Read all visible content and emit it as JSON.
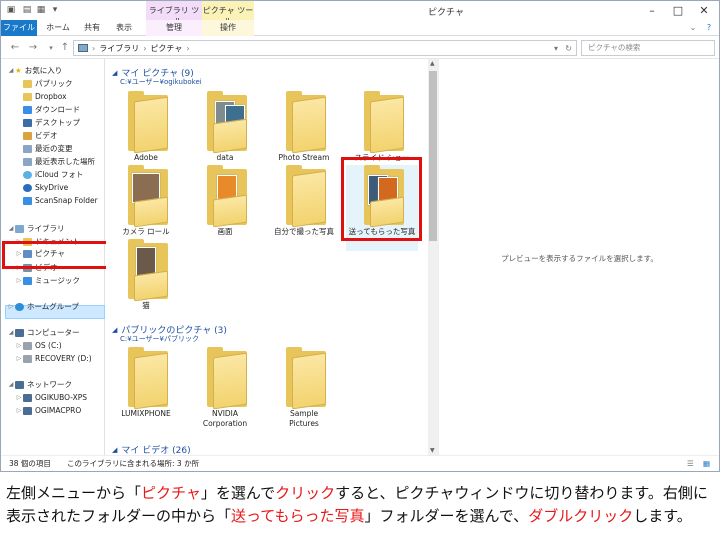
{
  "window": {
    "title": "ピクチャ",
    "ribbon_context_tabs": [
      "ライブラリ ツール",
      "ピクチャ ツール"
    ],
    "ribbon_tabs": [
      "ファイル",
      "ホーム",
      "共有",
      "表示",
      "管理",
      "操作"
    ]
  },
  "address": {
    "breadcrumb": [
      "ライブラリ",
      "ピクチャ"
    ],
    "search_placeholder": "ピクチャの検索"
  },
  "nav": {
    "favorites": "お気に入り",
    "favorites_items": [
      "パブリック",
      "Dropbox",
      "ダウンロード",
      "デスクトップ",
      "ビデオ",
      "最近の変更",
      "最近表示した場所",
      "iCloud フォト",
      "SkyDrive",
      "ScanSnap Folder"
    ],
    "libraries": "ライブラリ",
    "library_items": [
      "ドキュメント",
      "ピクチャ",
      "ビデオ",
      "ミュージック"
    ],
    "homegroup": "ホームグループ",
    "computer": "コンピューター",
    "computer_items": [
      "OS (C:)",
      "RECOVERY (D:)"
    ],
    "network": "ネットワーク",
    "network_items": [
      "OGIKUBO-XPS",
      "OGIMACPRO"
    ]
  },
  "groups": [
    {
      "title": "マイ ピクチャ (9)",
      "path": "C:¥ユーザー¥ogikubokei",
      "folders": [
        "Adobe",
        "data",
        "Photo Stream",
        "スライド ショー",
        "カメラ ロール",
        "画面",
        "自分で撮った写真",
        "送ってもらった写真",
        "猫"
      ]
    },
    {
      "title": "パブリックのピクチャ (3)",
      "path": "C:¥ユーザー¥パブリック",
      "folders": [
        "LUMIXPHONE",
        "NVIDIA Corporation",
        "Sample Pictures"
      ]
    },
    {
      "title": "マイ ビデオ (26)"
    }
  ],
  "preview_text": "プレビューを表示するファイルを選択します。",
  "status": {
    "count": "38 個の項目",
    "location": "このライブラリに含まれる場所: 3 か所"
  },
  "caption": {
    "p1": "左側メニューから「",
    "r1": "ピクチャ",
    "p2": "」を選んで",
    "r2": "クリック",
    "p3": "すると、ピクチャウィンドウに切り替わります。右側に表示されたフォルダーの中から「",
    "r3": "送ってもらった写真",
    "p4": "」フォルダーを選んで、",
    "r4": "ダブルクリック",
    "p5": "します。"
  },
  "colors": {
    "accent": "#1979ca",
    "highlight": "#e01010",
    "folder": "#e7c55a"
  }
}
